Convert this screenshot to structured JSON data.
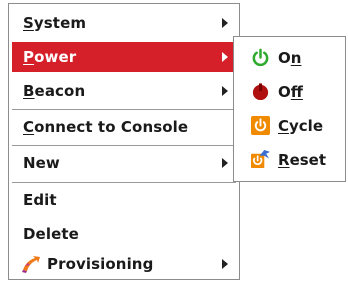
{
  "menu": {
    "items": [
      {
        "u": "S",
        "rest": "ystem",
        "submenu": true
      },
      {
        "u": "P",
        "rest": "ower",
        "submenu": true,
        "highlighted": true
      },
      {
        "u": "B",
        "rest": "eacon",
        "submenu": true
      },
      {
        "u": "C",
        "rest": "onnect to Console",
        "submenu": false
      },
      {
        "u": "",
        "rest": "New",
        "submenu": true
      },
      {
        "u": "",
        "rest": "Edit",
        "submenu": false
      },
      {
        "u": "",
        "rest": "Delete",
        "submenu": false
      },
      {
        "u": "",
        "rest": "Provisioning",
        "submenu": true,
        "icon": "provisioning-icon"
      }
    ]
  },
  "power_submenu": {
    "items": [
      {
        "pre": "O",
        "u": "n",
        "post": "",
        "icon": "power-on-icon"
      },
      {
        "pre": "O",
        "u": "f",
        "post": "f",
        "icon": "power-off-icon"
      },
      {
        "pre": "",
        "u": "C",
        "post": "ycle",
        "icon": "power-cycle-icon"
      },
      {
        "pre": "",
        "u": "R",
        "post": "eset",
        "icon": "reset-icon"
      }
    ]
  },
  "colors": {
    "highlight": "#d5202a",
    "power_on": "#2eaa2e",
    "power_off": "#b01010",
    "cycle": "#f08a00"
  }
}
